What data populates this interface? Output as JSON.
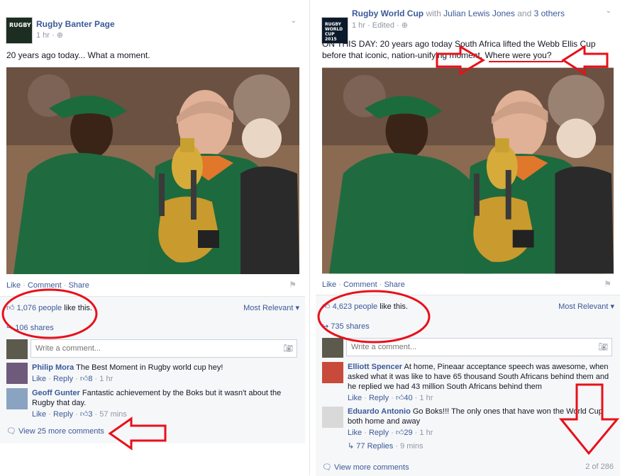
{
  "post_a": {
    "page_name": "Rugby Banter Page",
    "avatar_text": "RUGBY",
    "time": "1 hr",
    "text": "20 years ago today... What a moment.",
    "like_label": "Like",
    "comment_label": "Comment",
    "share_label": "Share",
    "likes_count": "1,076 people",
    "likes_suffix": " like this.",
    "sort_label": "Most Relevant",
    "shares": "106 shares",
    "comment_placeholder": "Write a comment...",
    "comments": [
      {
        "name": "Philip Mora",
        "text": "The Best Moment in Rugby world cup hey!",
        "like": "Like",
        "reply": "Reply",
        "likes": "8",
        "time": "1 hr"
      },
      {
        "name": "Geoff Gunter",
        "text": "Fantastic achievement by the Boks but it wasn't about the Rugby that day.",
        "like": "Like",
        "reply": "Reply",
        "likes": "3",
        "time": "57 mins"
      }
    ],
    "view_more": "View 25 more comments"
  },
  "post_b": {
    "page_name": "Rugby World Cup",
    "with_text": "with",
    "tagged_person": "Julian Lewis Jones",
    "and_text": "and",
    "others": "3 others",
    "avatar_text": "RUGBY WORLD CUP 2015",
    "time": "1 hr",
    "edited": "Edited",
    "text_line1": "ON THIS DAY: 20 years ago today South Africa lifted the Webb Ellis Cup",
    "text_line2": "before that iconic, nation-unifying moment. Where were you?",
    "like_label": "Like",
    "comment_label": "Comment",
    "share_label": "Share",
    "likes_count": "4,623 people",
    "likes_suffix": " like this.",
    "sort_label": "Most Relevant",
    "shares": "735 shares",
    "comment_placeholder": "Write a comment...",
    "comments": [
      {
        "name": "Elliott Spencer",
        "text": "At home, Pineaar acceptance speech was awesome, when asked what it was like to have 65 thousand South Africans behind them and he replied we had 43 million South Africans behind them",
        "like": "Like",
        "reply": "Reply",
        "likes": "40",
        "time": "1 hr"
      },
      {
        "name": "Eduardo Antonio",
        "text": "Go Boks!!! The only ones that have won the World Cup both home and away",
        "like": "Like",
        "reply": "Reply",
        "likes": "29",
        "time": "1 hr"
      }
    ],
    "replies": "77 Replies",
    "replies_time": "9 mins",
    "view_more": "View more comments",
    "pager": "2 of 286"
  },
  "colors": {
    "link": "#3b5998",
    "muted": "#9197a3",
    "annotation": "#e8101a",
    "ufi_bg": "#f6f7f9"
  }
}
